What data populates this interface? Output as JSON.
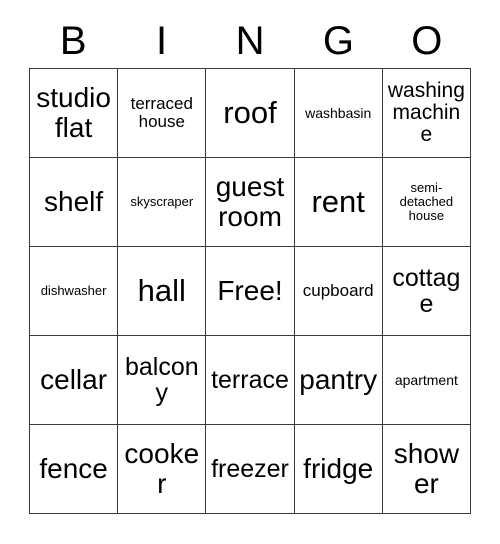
{
  "card": {
    "header": {
      "letters": [
        "B",
        "I",
        "N",
        "G",
        "O"
      ]
    },
    "grid": {
      "rows": 5,
      "columns": 5,
      "border_color": "#3a3a3a",
      "background_color": "#ffffff",
      "text_color": "#000000",
      "free_space": {
        "label": "Free!",
        "row": 3,
        "column": 3
      },
      "cells": [
        [
          {
            "text": "studio flat"
          },
          {
            "text": "terraced house"
          },
          {
            "text": "roof"
          },
          {
            "text": "washbasin"
          },
          {
            "text": "washing machine"
          }
        ],
        [
          {
            "text": "shelf"
          },
          {
            "text": "skyscraper"
          },
          {
            "text": "guest room"
          },
          {
            "text": "rent"
          },
          {
            "text": "semi-detached house"
          }
        ],
        [
          {
            "text": "dishwasher"
          },
          {
            "text": "hall"
          },
          {
            "text": "Free!"
          },
          {
            "text": "cupboard"
          },
          {
            "text": "cottage"
          }
        ],
        [
          {
            "text": "cellar"
          },
          {
            "text": "balcony"
          },
          {
            "text": "terrace"
          },
          {
            "text": "pantry"
          },
          {
            "text": "apartment"
          }
        ],
        [
          {
            "text": "fence"
          },
          {
            "text": "cooker"
          },
          {
            "text": "freezer"
          },
          {
            "text": "fridge"
          },
          {
            "text": "shower"
          }
        ]
      ]
    }
  }
}
